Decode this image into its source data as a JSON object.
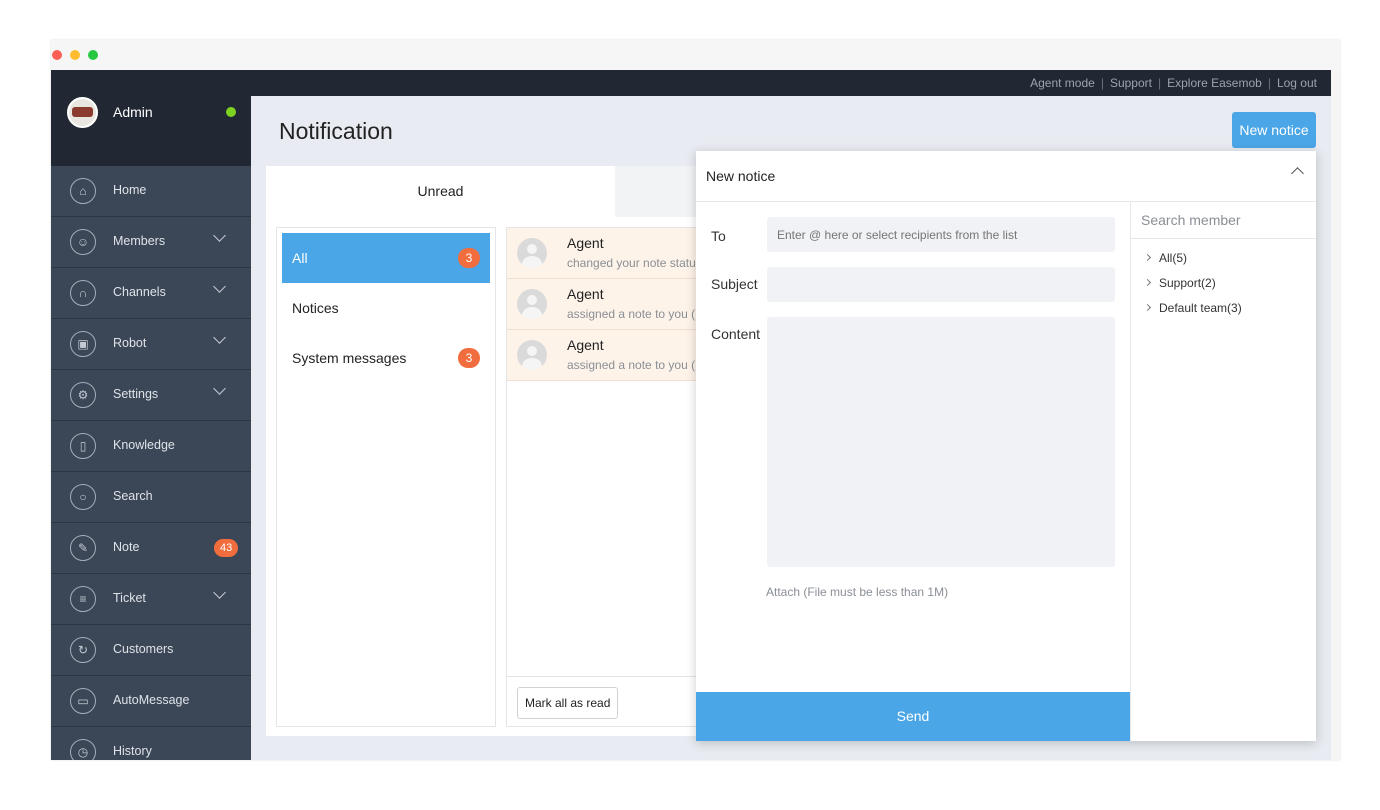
{
  "topbar": {
    "links": [
      "Agent mode",
      "Support",
      "Explore Easemob",
      "Log out"
    ],
    "separator": "|"
  },
  "profile": {
    "name": "Admin",
    "status_color": "#7ed321"
  },
  "sidebar": {
    "items": [
      {
        "label": "Home",
        "icon": "home-icon",
        "has_chevron": false
      },
      {
        "label": "Members",
        "icon": "members-icon",
        "has_chevron": true
      },
      {
        "label": "Channels",
        "icon": "channels-icon",
        "has_chevron": true
      },
      {
        "label": "Robot",
        "icon": "robot-icon",
        "has_chevron": true
      },
      {
        "label": "Settings",
        "icon": "settings-icon",
        "has_chevron": true
      },
      {
        "label": "Knowledge",
        "icon": "knowledge-icon",
        "has_chevron": false
      },
      {
        "label": "Search",
        "icon": "search-icon",
        "has_chevron": false
      },
      {
        "label": "Note",
        "icon": "note-icon",
        "badge": "43"
      },
      {
        "label": "Ticket",
        "icon": "ticket-icon",
        "has_chevron": true
      },
      {
        "label": "Customers",
        "icon": "customers-icon",
        "has_chevron": false
      },
      {
        "label": "AutoMessage",
        "icon": "automessage-icon",
        "has_chevron": false
      },
      {
        "label": "History",
        "icon": "history-icon",
        "has_chevron": false
      }
    ]
  },
  "main": {
    "title": "Notification",
    "new_notice_label": "New notice",
    "tabs": [
      {
        "label": "Unread"
      },
      {
        "label": ""
      }
    ],
    "filters": [
      {
        "label": "All",
        "count": "3",
        "active": true
      },
      {
        "label": "Notices",
        "count": ""
      },
      {
        "label": "System messages",
        "count": "3"
      }
    ],
    "messages": [
      {
        "name": "Agent",
        "text": "changed your note statu"
      },
      {
        "name": "Agent",
        "text": "assigned a note to you ("
      },
      {
        "name": "Agent",
        "text": "assigned a note to you ("
      }
    ],
    "mark_all_label": "Mark all as read"
  },
  "notice_panel": {
    "title": "New notice",
    "to_label": "To",
    "to_placeholder": "Enter @ here or select recipients from the list",
    "subject_label": "Subject",
    "subject_value": "",
    "content_label": "Content",
    "content_value": "",
    "attach_text": "Attach (File must be less than 1M)",
    "send_label": "Send",
    "member_search_placeholder": "Search member",
    "groups": [
      {
        "label": "All(5)"
      },
      {
        "label": "Support(2)"
      },
      {
        "label": "Default team(3)"
      }
    ]
  },
  "colors": {
    "accent": "#4aa6e7",
    "badge": "#f26d3d",
    "sidebar_bg": "#3b4657",
    "topbar_bg": "#212833",
    "unread_row_bg": "#fdf3e9"
  }
}
